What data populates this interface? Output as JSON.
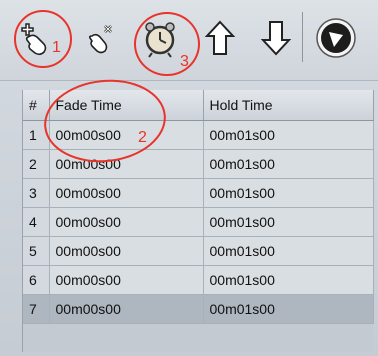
{
  "toolbar": {
    "buttons": [
      {
        "name": "add-keyframe-button",
        "icon": "hand-plus-icon"
      },
      {
        "name": "remove-keyframe-button",
        "icon": "hand-remove-icon"
      },
      {
        "name": "timer-button",
        "icon": "alarm-clock-icon"
      },
      {
        "name": "move-up-button",
        "icon": "arrow-up-icon"
      },
      {
        "name": "move-down-button",
        "icon": "arrow-down-icon"
      },
      {
        "name": "play-button",
        "icon": "play-circle-icon"
      }
    ]
  },
  "table": {
    "headers": {
      "num": "#",
      "fade": "Fade Time",
      "hold": "Hold Time"
    },
    "rows": [
      {
        "num": "1",
        "fade": "00m00s00",
        "hold": "00m01s00"
      },
      {
        "num": "2",
        "fade": "00m00s00",
        "hold": "00m01s00"
      },
      {
        "num": "3",
        "fade": "00m00s00",
        "hold": "00m01s00"
      },
      {
        "num": "4",
        "fade": "00m00s00",
        "hold": "00m01s00"
      },
      {
        "num": "5",
        "fade": "00m00s00",
        "hold": "00m01s00"
      },
      {
        "num": "6",
        "fade": "00m00s00",
        "hold": "00m01s00"
      },
      {
        "num": "7",
        "fade": "00m00s00",
        "hold": "00m01s00"
      }
    ],
    "selected_row": "7"
  },
  "annotations": {
    "one": "1",
    "two": "2",
    "three": "3",
    "color": "#e8342a"
  }
}
